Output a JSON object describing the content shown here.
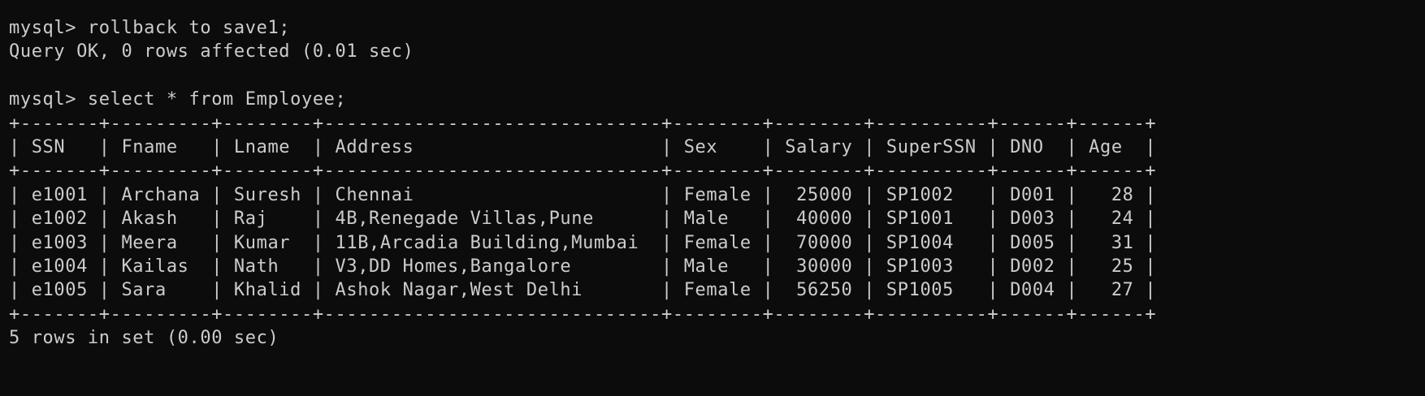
{
  "terminal": {
    "lines": [
      "mysql> rollback to save1;",
      "Query OK, 0 rows affected (0.01 sec)",
      "",
      "mysql> select * from Employee;",
      "+-------+---------+--------+------------------------------+--------+--------+----------+------+------+",
      "| SSN   | Fname   | Lname  | Address                      | Sex    | Salary | SuperSSN | DNO  | Age  |",
      "+-------+---------+--------+------------------------------+--------+--------+----------+------+------+",
      "| e1001 | Archana | Suresh | Chennai                      | Female |  25000 | SP1002   | D001 |   28 |",
      "| e1002 | Akash   | Raj    | 4B,Renegade Villas,Pune      | Male   |  40000 | SP1001   | D003 |   24 |",
      "| e1003 | Meera   | Kumar  | 11B,Arcadia Building,Mumbai  | Female |  70000 | SP1004   | D005 |   31 |",
      "| e1004 | Kailas  | Nath   | V3,DD Homes,Bangalore        | Male   |  30000 | SP1003   | D002 |   25 |",
      "| e1005 | Sara    | Khalid | Ashok Nagar,West Delhi       | Female |  56250 | SP1005   | D004 |   27 |",
      "+-------+---------+--------+------------------------------+--------+--------+----------+------+------+",
      "5 rows in set (0.00 sec)"
    ]
  }
}
